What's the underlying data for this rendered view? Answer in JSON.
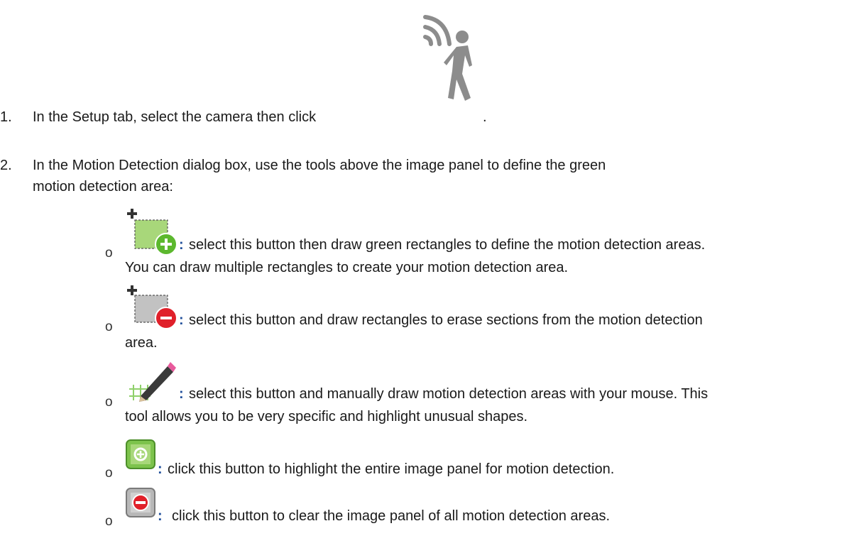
{
  "steps": [
    {
      "number": "1.",
      "text_before_icon": "In the Setup tab, select the camera then click",
      "icon": "motion-detection-icon",
      "text_after_icon": "."
    },
    {
      "number": "2.",
      "line1": "In the Motion Detection dialog box, use the tools above the image panel to define the green",
      "line2": "motion detection area:"
    }
  ],
  "bullet_symbol": "o",
  "tools": [
    {
      "icon": "add-rectangle-icon",
      "colon": ":",
      "line1": "select this button then draw green rectangles to define the motion detection areas.",
      "line2": "You can draw multiple rectangles to create your motion detection area."
    },
    {
      "icon": "erase-rectangle-icon",
      "colon": ":",
      "line1": "select this button and draw rectangles to erase sections from the motion detection",
      "line2": "area."
    },
    {
      "icon": "pencil-grid-icon",
      "colon": ":",
      "line1": "select this button and manually draw motion detection areas with your mouse. This",
      "line2": "tool allows you to be very specific and highlight unusual shapes."
    },
    {
      "icon": "select-all-icon",
      "colon": ":",
      "line1": "click this button to highlight the entire image panel for motion detection."
    },
    {
      "icon": "clear-all-icon",
      "colon": ":",
      "line1": "click this button to clear the image panel of all motion detection areas."
    }
  ],
  "colors": {
    "text": "#1a1a1a",
    "colon_accent": "#1f4e9a",
    "green_fill": "#a8d77a",
    "green_circle": "#5cb82e",
    "red_circle": "#e0202a",
    "icon_gray": "#8c8c8c"
  }
}
